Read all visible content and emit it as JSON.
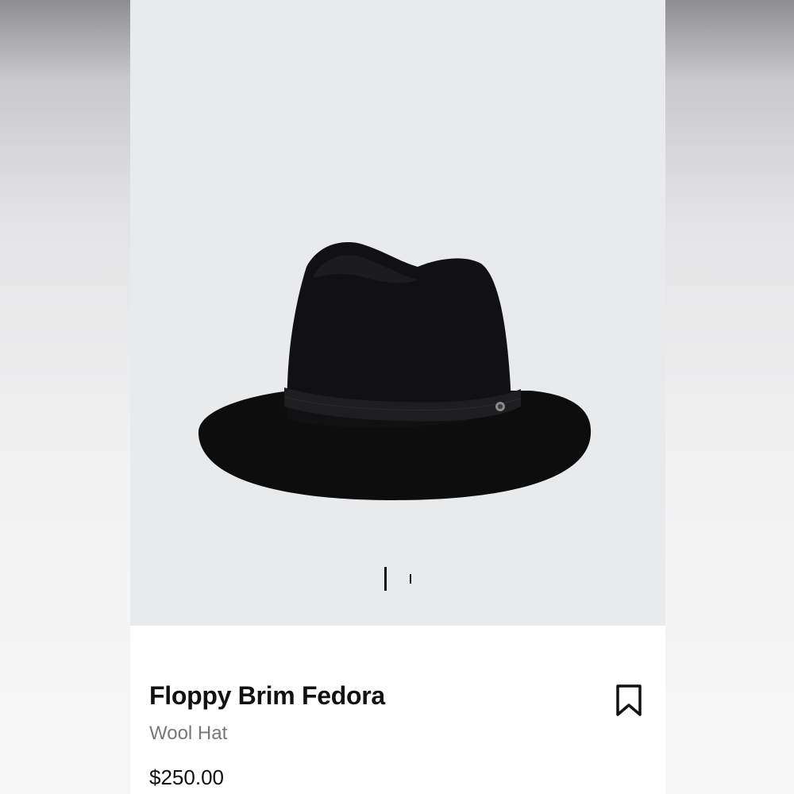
{
  "product": {
    "title": "Floppy Brim Fedora",
    "subtitle": "Wool Hat",
    "price": "$250.00"
  },
  "gallery": {
    "image_count": 2,
    "active_index": 0,
    "background_color": "#e9eaec"
  },
  "icons": {
    "save": "bookmark-icon"
  },
  "colors": {
    "text_primary": "#111111",
    "text_secondary": "#777777"
  }
}
